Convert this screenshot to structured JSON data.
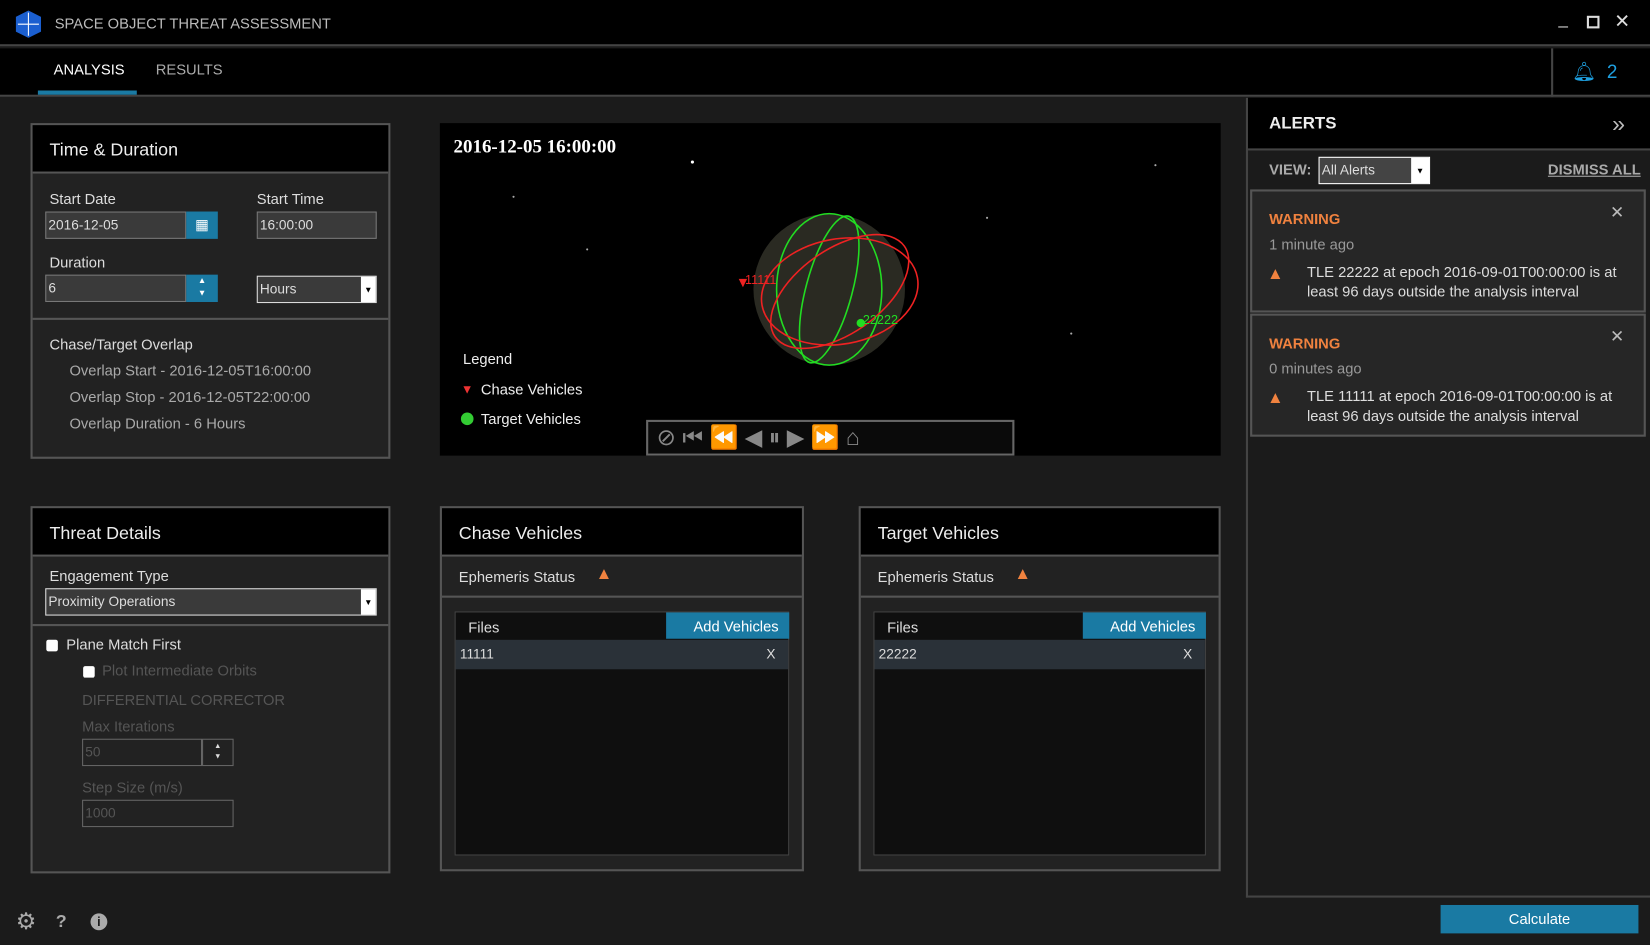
{
  "app": {
    "title": "SPACE OBJECT THREAT ASSESSMENT",
    "accent": "#1a7aa3",
    "warning_color": "#f0823f"
  },
  "tabs": [
    {
      "label": "ANALYSIS",
      "active": true
    },
    {
      "label": "RESULTS",
      "active": false
    }
  ],
  "notifications": {
    "count": "2",
    "icon": "bell-icon"
  },
  "time_duration": {
    "title": "Time & Duration",
    "start_date_label": "Start Date",
    "start_date": "2016-12-05",
    "start_time_label": "Start Time",
    "start_time": "16:00:00",
    "duration_label": "Duration",
    "duration": "6",
    "duration_unit": "Hours",
    "overlap_title": "Chase/Target Overlap",
    "overlap_start": "Overlap Start - 2016-12-05T16:00:00",
    "overlap_stop": "Overlap Stop - 2016-12-05T22:00:00",
    "overlap_duration": "Overlap Duration - 6 Hours"
  },
  "viewer": {
    "timestamp": "2016-12-05 16:00:00",
    "legend_title": "Legend",
    "legend_chase": "Chase Vehicles",
    "legend_target": "Target Vehicles",
    "chase_label": "11111",
    "target_label": "22222"
  },
  "threat": {
    "title": "Threat Details",
    "engagement_label": "Engagement Type",
    "engagement_value": "Proximity Operations",
    "plane_match": "Plane Match First",
    "plot_intermediate": "Plot Intermediate Orbits",
    "diff_corrector": "DIFFERENTIAL CORRECTOR",
    "max_iter_label": "Max Iterations",
    "max_iter": "50",
    "step_size_label": "Step Size (m/s)",
    "step_size": "1000"
  },
  "chase": {
    "title": "Chase Vehicles",
    "ephemeris": "Ephemeris Status",
    "files_label": "Files",
    "add_label": "Add Vehicles",
    "rows": [
      {
        "name": "11111",
        "remove": "X"
      }
    ]
  },
  "target": {
    "title": "Target Vehicles",
    "ephemeris": "Ephemeris Status",
    "files_label": "Files",
    "add_label": "Add Vehicles",
    "rows": [
      {
        "name": "22222",
        "remove": "X"
      }
    ]
  },
  "alerts": {
    "title": "ALERTS",
    "view_label": "VIEW:",
    "view_value": "All Alerts",
    "dismiss_all": "DISMISS ALL",
    "items": [
      {
        "level": "WARNING",
        "time": "1 minute ago",
        "message": "TLE 22222 at epoch 2016-09-01T00:00:00 is at least 96 days outside the analysis interval"
      },
      {
        "level": "WARNING",
        "time": "0 minutes ago",
        "message": "TLE 11111 at epoch 2016-09-01T00:00:00 is at least 96 days outside the analysis interval"
      }
    ]
  },
  "footer": {
    "calculate": "Calculate",
    "help": "?"
  }
}
